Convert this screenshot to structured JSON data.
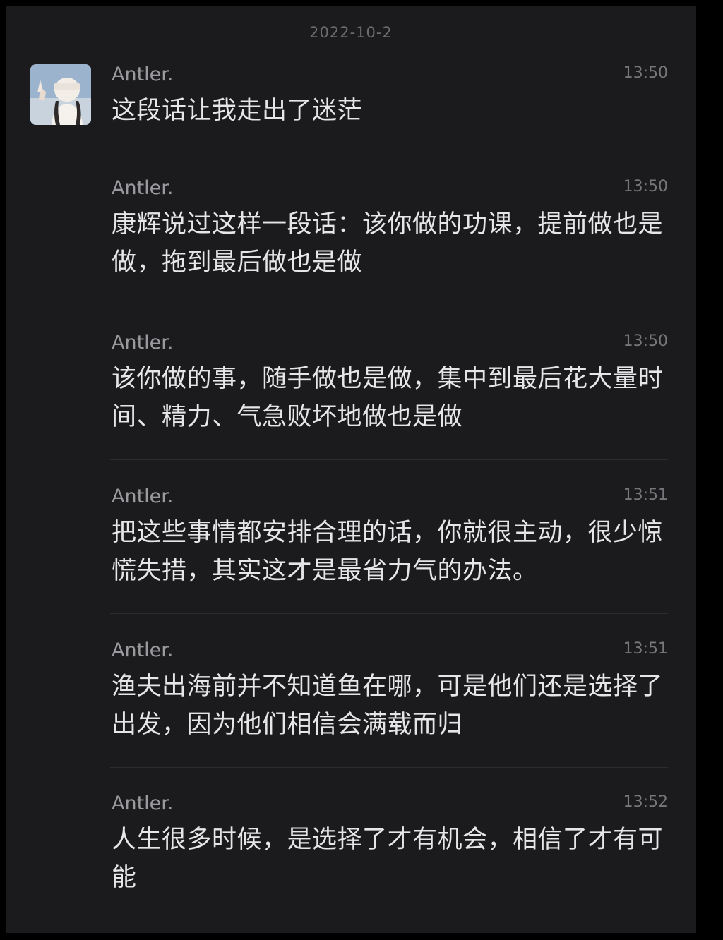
{
  "chat": {
    "date": "2022-10-2",
    "avatar_icon": "user-avatar-photo",
    "colors": {
      "background": "#1b1b1d",
      "text": "#e6e6e8",
      "meta": "#9a9a9e"
    },
    "messages": [
      {
        "sender": "Antler.",
        "time": "13:50",
        "text": "这段话让我走出了迷茫"
      },
      {
        "sender": "Antler.",
        "time": "13:50",
        "text": "康辉说过这样一段话：该你做的功课，提前做也是做，拖到最后做也是做"
      },
      {
        "sender": "Antler.",
        "time": "13:50",
        "text": "该你做的事，随手做也是做，集中到最后花大量时间、精力、气急败坏地做也是做"
      },
      {
        "sender": "Antler.",
        "time": "13:51",
        "text": "把这些事情都安排合理的话，你就很主动，很少惊慌失措，其实这才是最省力气的办法。"
      },
      {
        "sender": "Antler.",
        "time": "13:51",
        "text": "渔夫出海前并不知道鱼在哪，可是他们还是选择了出发，因为他们相信会满载而归"
      },
      {
        "sender": "Antler.",
        "time": "13:52",
        "text": "人生很多时候，是选择了才有机会，相信了才有可能"
      }
    ]
  }
}
